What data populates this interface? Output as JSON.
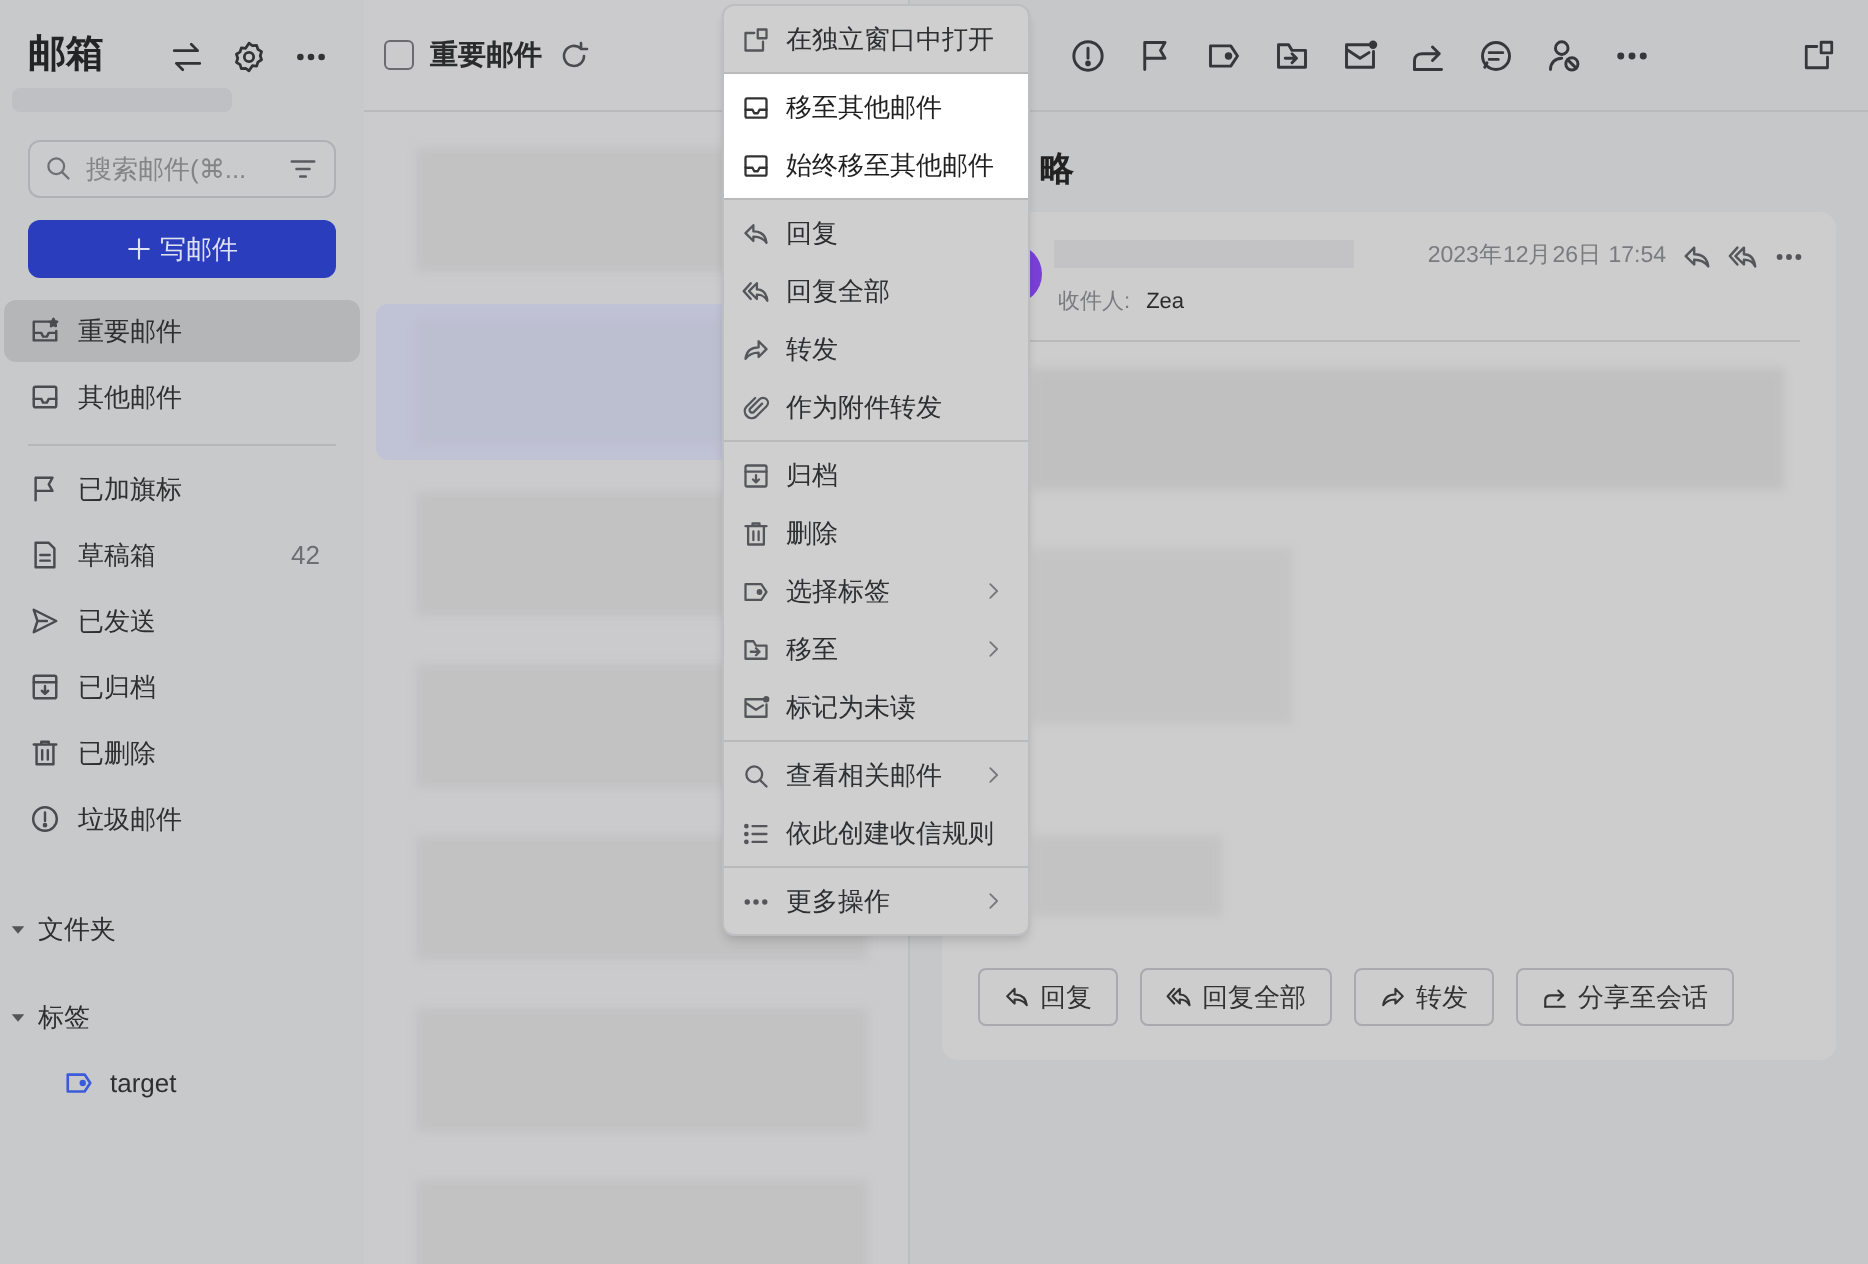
{
  "sidebar": {
    "title": "邮箱",
    "header_icons": [
      {
        "kind": "swap"
      },
      {
        "kind": "settings"
      },
      {
        "kind": "more"
      }
    ],
    "search": {
      "placeholder": "搜索邮件(⌘..."
    },
    "compose": {
      "label": "写邮件"
    },
    "nav": [
      {
        "kind": "inbox-star",
        "label": "重要邮件",
        "selected": true
      },
      {
        "kind": "inbox",
        "label": "其他邮件",
        "selected": false
      },
      {
        "kind": "divider"
      },
      {
        "kind": "flag",
        "label": "已加旗标",
        "selected": false
      },
      {
        "kind": "draft",
        "label": "草稿箱",
        "count": "42",
        "selected": false
      },
      {
        "kind": "send",
        "label": "已发送",
        "selected": false
      },
      {
        "kind": "archive",
        "label": "已归档",
        "selected": false
      },
      {
        "kind": "trash",
        "label": "已删除",
        "selected": false
      },
      {
        "kind": "alert",
        "label": "垃圾邮件",
        "selected": false
      }
    ],
    "sections": [
      {
        "label": "文件夹",
        "expanded": true
      },
      {
        "label": "标签",
        "expanded": true,
        "children": [
          {
            "label": "target",
            "color": "#3b5bdb"
          }
        ]
      }
    ]
  },
  "list": {
    "title": "重要邮件",
    "checked": false,
    "messages": [
      {
        "selected": false
      },
      {
        "selected": true
      },
      {
        "selected": false
      },
      {
        "selected": false
      },
      {
        "selected": false
      },
      {
        "selected": false
      },
      {
        "selected": false
      }
    ]
  },
  "toolbar": [
    {
      "kind": "alert"
    },
    {
      "kind": "flag"
    },
    {
      "kind": "tag"
    },
    {
      "kind": "move"
    },
    {
      "kind": "mail-dot"
    },
    {
      "kind": "share"
    },
    {
      "kind": "chat"
    },
    {
      "kind": "user-block"
    },
    {
      "kind": "more"
    }
  ],
  "reader": {
    "title": "略",
    "date": "2023年12月26日 17:54",
    "recipient_label": "收件人:",
    "recipient": "Zea",
    "buttons": [
      {
        "kind": "reply",
        "label": "回复"
      },
      {
        "kind": "reply-all",
        "label": "回复全部"
      },
      {
        "kind": "forward",
        "label": "转发"
      },
      {
        "kind": "share",
        "label": "分享至会话"
      }
    ]
  },
  "context_menu": {
    "groups": [
      [
        {
          "kind": "popout",
          "label": "在独立窗口中打开",
          "highlighted": false,
          "submenu": false
        }
      ],
      [
        {
          "kind": "inbox",
          "label": "移至其他邮件",
          "highlighted": true,
          "submenu": false
        },
        {
          "kind": "inbox",
          "label": "始终移至其他邮件",
          "highlighted": true,
          "submenu": false
        }
      ],
      [
        {
          "kind": "reply",
          "label": "回复",
          "highlighted": false,
          "submenu": false
        },
        {
          "kind": "reply-all",
          "label": "回复全部",
          "highlighted": false,
          "submenu": false
        },
        {
          "kind": "forward",
          "label": "转发",
          "highlighted": false,
          "submenu": false
        },
        {
          "kind": "paperclip",
          "label": "作为附件转发",
          "highlighted": false,
          "submenu": false
        }
      ],
      [
        {
          "kind": "archive",
          "label": "归档",
          "highlighted": false,
          "submenu": false
        },
        {
          "kind": "trash",
          "label": "删除",
          "highlighted": false,
          "submenu": false
        },
        {
          "kind": "tag",
          "label": "选择标签",
          "highlighted": false,
          "submenu": true
        },
        {
          "kind": "move",
          "label": "移至",
          "highlighted": false,
          "submenu": true
        },
        {
          "kind": "mail-dot",
          "label": "标记为未读",
          "highlighted": false,
          "submenu": false
        }
      ],
      [
        {
          "kind": "search",
          "label": "查看相关邮件",
          "highlighted": false,
          "submenu": true
        },
        {
          "kind": "list",
          "label": "依此创建收信规则",
          "highlighted": false,
          "submenu": false
        }
      ],
      [
        {
          "kind": "more",
          "label": "更多操作",
          "highlighted": false,
          "submenu": true
        }
      ]
    ]
  }
}
